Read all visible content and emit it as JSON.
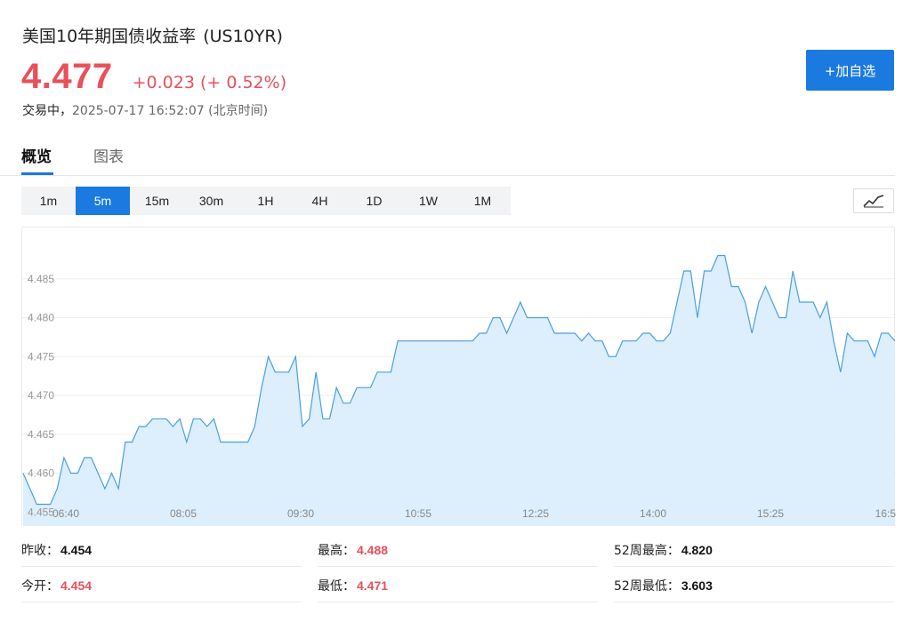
{
  "header": {
    "name": "美国10年期国债收益率",
    "code": "(US10YR)",
    "price": "4.477",
    "change": "+0.023 (+ 0.52%)",
    "state": "交易中，",
    "timestamp": "2025-07-17 16:52:07 (北京时间)",
    "add_button": "+加自选"
  },
  "colors": {
    "up": "#e8505b",
    "accent": "#1a7ae0",
    "line": "#4a9fe0",
    "fill": "#ddeefc"
  },
  "tabs": [
    {
      "label": "概览",
      "active": true
    },
    {
      "label": "图表",
      "active": false
    }
  ],
  "intervals": [
    {
      "label": "1m",
      "active": false
    },
    {
      "label": "5m",
      "active": true
    },
    {
      "label": "15m",
      "active": false
    },
    {
      "label": "30m",
      "active": false
    },
    {
      "label": "1H",
      "active": false
    },
    {
      "label": "4H",
      "active": false
    },
    {
      "label": "1D",
      "active": false
    },
    {
      "label": "1W",
      "active": false
    },
    {
      "label": "1M",
      "active": false
    }
  ],
  "chart_toggle_icon": "line-chart-icon",
  "chart_data": {
    "type": "area",
    "ylim": [
      4.4532,
      4.4916
    ],
    "yticks": [
      "4.485",
      "4.480",
      "4.475",
      "4.470",
      "4.465",
      "4.460",
      "4.455"
    ],
    "xtick_labels": [
      "06:40",
      "08:05",
      "09:30",
      "10:55",
      "12:25",
      "14:00",
      "15:25",
      "16:5"
    ],
    "grid": true,
    "values": [
      4.46,
      4.458,
      4.456,
      4.456,
      4.456,
      4.458,
      4.462,
      4.46,
      4.46,
      4.462,
      4.462,
      4.46,
      4.458,
      4.46,
      4.458,
      4.464,
      4.464,
      4.466,
      4.466,
      4.467,
      4.467,
      4.467,
      4.466,
      4.467,
      4.464,
      4.467,
      4.467,
      4.466,
      4.467,
      4.464,
      4.464,
      4.464,
      4.464,
      4.464,
      4.466,
      4.471,
      4.475,
      4.473,
      4.473,
      4.473,
      4.475,
      4.466,
      4.467,
      4.473,
      4.467,
      4.467,
      4.471,
      4.469,
      4.469,
      4.471,
      4.471,
      4.471,
      4.473,
      4.473,
      4.473,
      4.477,
      4.477,
      4.477,
      4.477,
      4.477,
      4.477,
      4.477,
      4.477,
      4.477,
      4.477,
      4.477,
      4.477,
      4.478,
      4.478,
      4.48,
      4.48,
      4.478,
      4.48,
      4.482,
      4.48,
      4.48,
      4.48,
      4.48,
      4.478,
      4.478,
      4.478,
      4.478,
      4.477,
      4.478,
      4.477,
      4.477,
      4.475,
      4.475,
      4.477,
      4.477,
      4.477,
      4.478,
      4.478,
      4.477,
      4.477,
      4.478,
      4.482,
      4.486,
      4.486,
      4.48,
      4.486,
      4.486,
      4.488,
      4.488,
      4.484,
      4.484,
      4.482,
      4.478,
      4.482,
      4.484,
      4.482,
      4.48,
      4.48,
      4.486,
      4.482,
      4.482,
      4.482,
      4.48,
      4.482,
      4.477,
      4.473,
      4.478,
      4.477,
      4.477,
      4.477,
      4.475,
      4.478,
      4.478,
      4.477
    ]
  },
  "stats": {
    "prev_close_label": "昨收：",
    "prev_close": "4.454",
    "high_label": "最高：",
    "high": "4.488",
    "w52_high_label": "52周最高：",
    "w52_high": "4.820",
    "open_label": "今开：",
    "open": "4.454",
    "low_label": "最低：",
    "low": "4.471",
    "w52_low_label": "52周最低：",
    "w52_low": "3.603"
  }
}
